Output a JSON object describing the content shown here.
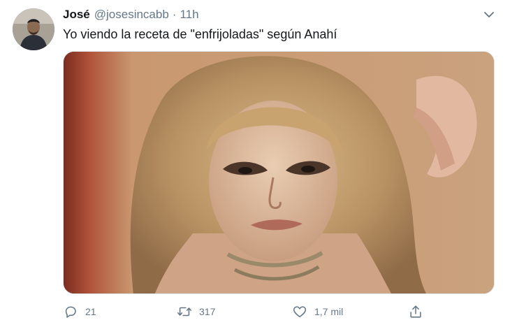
{
  "tweet": {
    "author_name": "José",
    "author_handle": "@josesincabb",
    "separator": "·",
    "time": "11h",
    "text": "Yo viendo la receta de \"enfrijoladas\" según Anahí",
    "media": {
      "kind": "video-still"
    }
  },
  "actions": {
    "reply_count": "21",
    "retweet_count": "317",
    "like_count": "1,7 mil"
  },
  "icons": {
    "menu": "chevron-down-icon",
    "reply": "reply-icon",
    "retweet": "retweet-icon",
    "like": "heart-icon",
    "share": "share-icon"
  },
  "colors": {
    "text": "#14171a",
    "secondary_text": "#657786",
    "icon": "#657786",
    "border": "#e1e8ed",
    "background": "#ffffff"
  }
}
